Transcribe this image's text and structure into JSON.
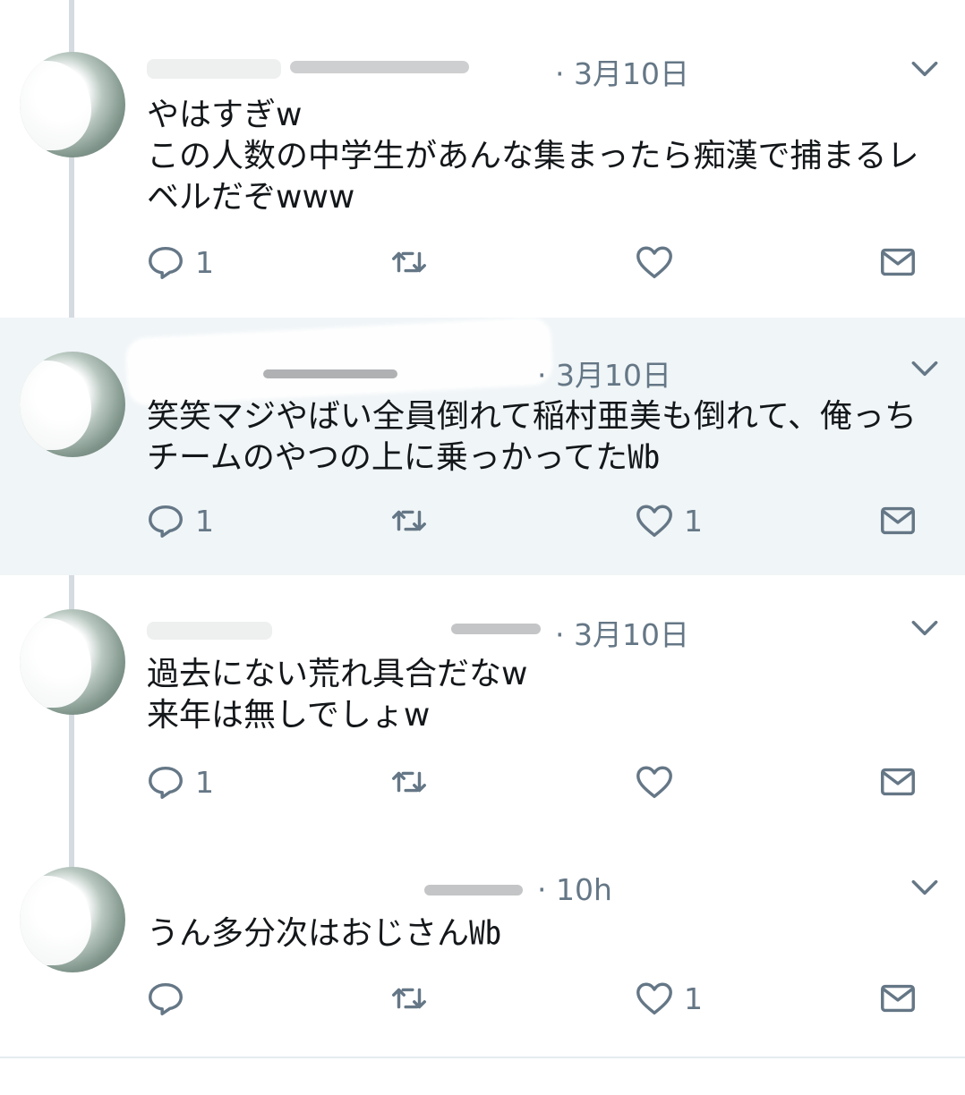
{
  "tweets": [
    {
      "timestamp": "· 3月10日",
      "text": "やはすぎw\nこの人数の中学生があんな集まったら痴漢で捕まるレベルだぞwww",
      "reply_count": "1",
      "like_count": "",
      "liked": false,
      "highlighted": false
    },
    {
      "timestamp": "· 3月10日",
      "text": "笑笑マジやばい全員倒れて稲村亜美も倒れて、俺っちチームのやつの上に乗っかってた㏝",
      "reply_count": "1",
      "like_count": "1",
      "liked": false,
      "highlighted": true
    },
    {
      "timestamp": "· 3月10日",
      "text": "過去にない荒れ具合だなw\n来年は無しでしょw",
      "reply_count": "1",
      "like_count": "",
      "liked": false,
      "highlighted": false
    },
    {
      "timestamp": "· 10h",
      "text": "うん多分次はおじさん㏝",
      "reply_count": "",
      "like_count": "1",
      "liked": false,
      "highlighted": false
    }
  ],
  "icons": {
    "reply": "reply-icon",
    "retweet": "retweet-icon",
    "like": "heart-icon",
    "dm": "envelope-icon",
    "more": "chevron-down-icon"
  },
  "colors": {
    "muted": "#657786",
    "highlight_bg": "#f0f5f7",
    "thread_line": "#d5dbe0"
  }
}
